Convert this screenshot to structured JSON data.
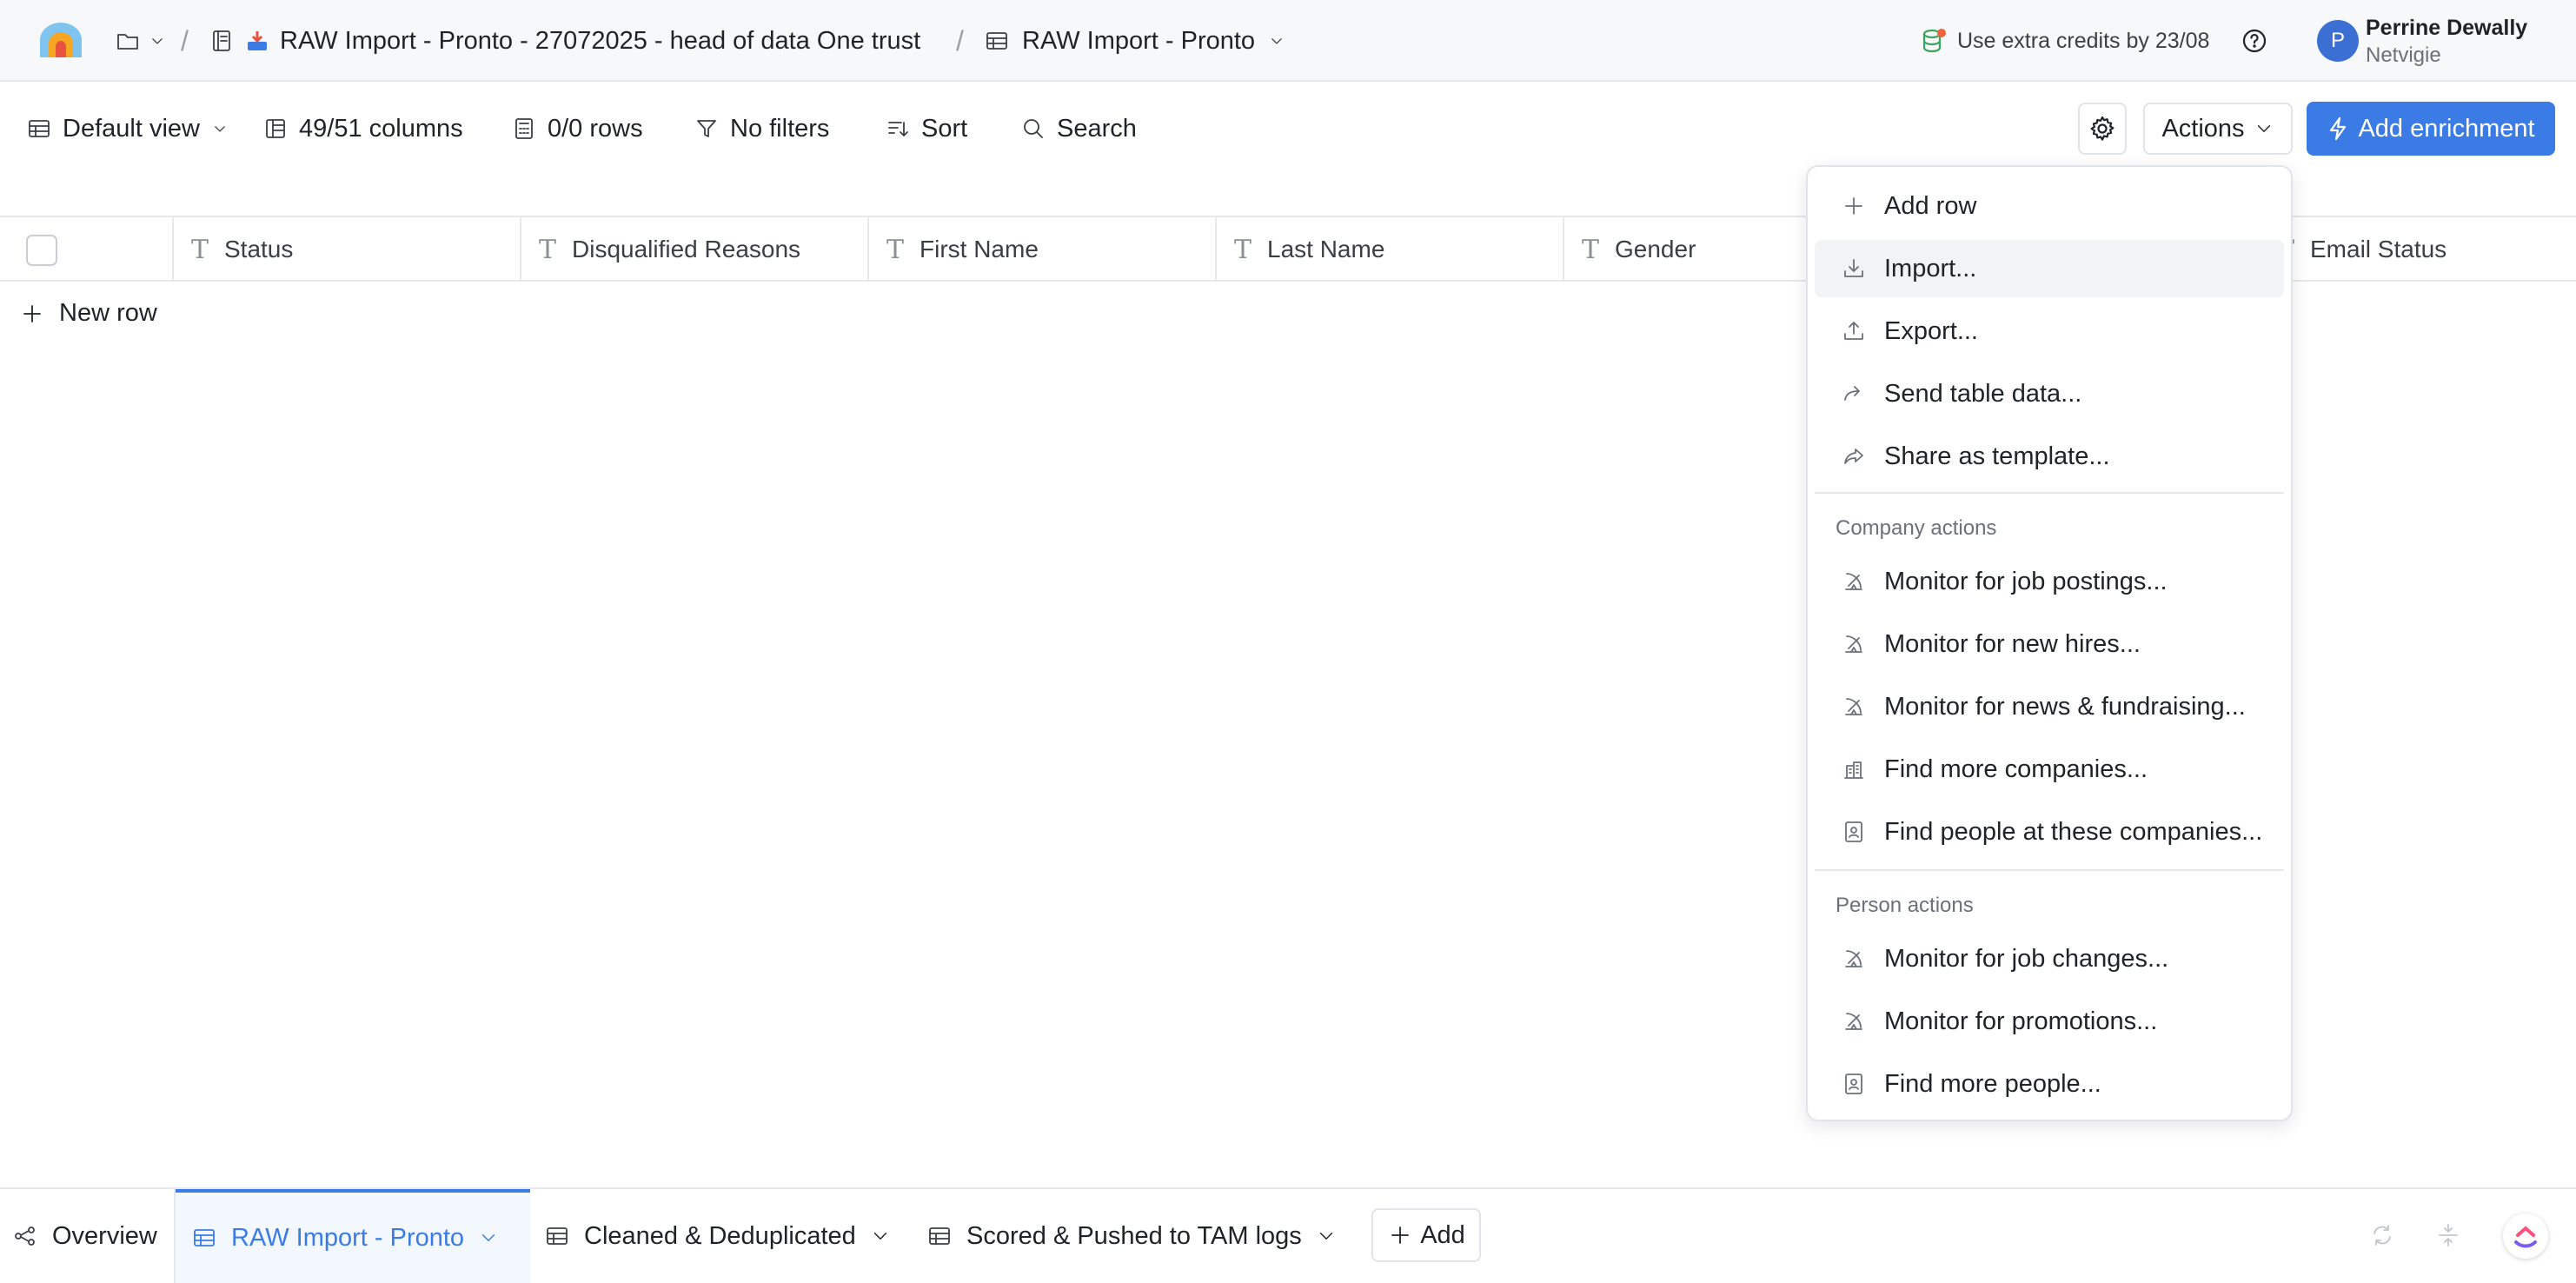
{
  "topbar": {
    "breadcrumb_doc": "RAW Import - Pronto - 27072025 - head of data One trust",
    "breadcrumb_view": "RAW Import - Pronto",
    "separator": "/",
    "credits": "Use extra credits by 23/08",
    "user_initial": "P",
    "user_name": "Perrine Dewally",
    "user_org": "Netvigie"
  },
  "toolbar": {
    "view": "Default view",
    "columns": "49/51 columns",
    "rows": "0/0 rows",
    "filters": "No filters",
    "sort": "Sort",
    "search": "Search",
    "actions": "Actions",
    "add_enrichment": "Add enrichment"
  },
  "columns": [
    "Status",
    "Disqualified Reasons",
    "First Name",
    "Last Name",
    "Gender",
    "Email Status"
  ],
  "new_row": "New row",
  "menu": {
    "items": [
      "Add row",
      "Import...",
      "Export...",
      "Send table data...",
      "Share as template..."
    ],
    "company_header": "Company actions",
    "company_items": [
      "Monitor for job postings...",
      "Monitor for new hires...",
      "Monitor for news & fundraising...",
      "Find more companies...",
      "Find people at these companies..."
    ],
    "person_header": "Person actions",
    "person_items": [
      "Monitor for job changes...",
      "Monitor for promotions...",
      "Find more people..."
    ]
  },
  "bottom_tabs": {
    "overview": "Overview",
    "tabs": [
      "RAW Import - Pronto",
      "Cleaned & Deduplicated",
      "Scored & Pushed to TAM logs"
    ],
    "add": "Add"
  },
  "colors": {
    "accent": "#3b7be6",
    "avatar": "#3b6fd4"
  }
}
